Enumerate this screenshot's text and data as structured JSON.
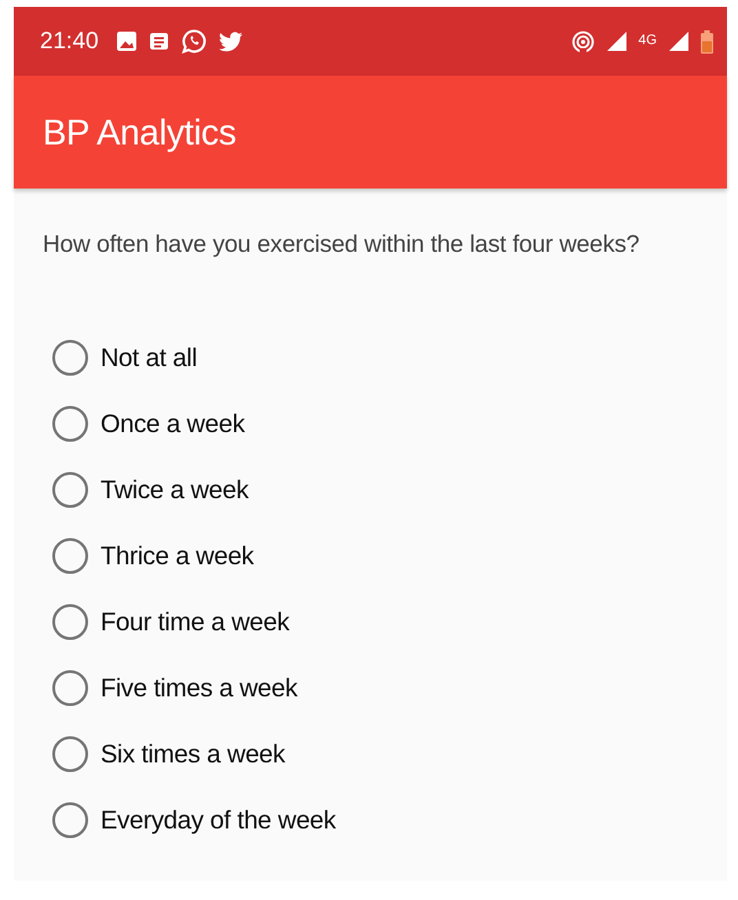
{
  "status_bar": {
    "time": "21:40",
    "network": "4G"
  },
  "app_bar": {
    "title": "BP Analytics"
  },
  "question": "How often have you exercised within the last four weeks?",
  "options": [
    {
      "label": "Not at all",
      "selected": false
    },
    {
      "label": "Once a week",
      "selected": false
    },
    {
      "label": "Twice a week",
      "selected": false
    },
    {
      "label": "Thrice a week",
      "selected": false
    },
    {
      "label": "Four time a week",
      "selected": false
    },
    {
      "label": "Five times a week",
      "selected": false
    },
    {
      "label": "Six times a week",
      "selected": false
    },
    {
      "label": "Everyday of the week",
      "selected": false
    }
  ]
}
